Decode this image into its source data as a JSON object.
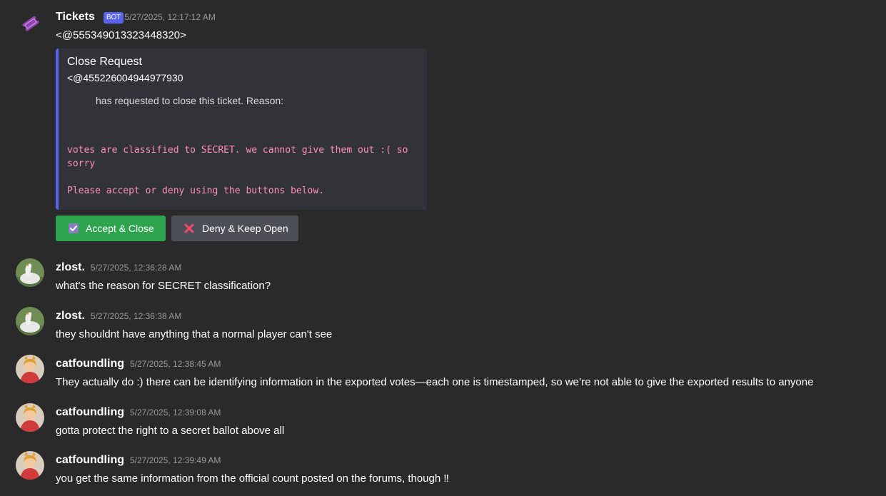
{
  "messages": [
    {
      "username": "Tickets",
      "badge": "BOT",
      "timestamp": "5/27/2025, 12:17:12 AM",
      "content": "<@555349013323448320>",
      "embed": {
        "title": "Close Request",
        "mention": "<@455226004944977930",
        "description": "has requested to close this ticket. Reason:",
        "code_lines": [
          "votes are classified to SECRET. we cannot give them out :( so",
          "sorry",
          "",
          "Please accept or deny using the buttons below."
        ],
        "accent_color": "#5865f2"
      },
      "buttons": {
        "accept_label": "Accept & Close",
        "deny_label": "Deny & Keep Open"
      }
    },
    {
      "username": "zlost.",
      "timestamp": "5/27/2025, 12:36:28 AM",
      "content": "what's the reason for SECRET classification?"
    },
    {
      "username": "zlost.",
      "timestamp": "5/27/2025, 12:36:38 AM",
      "content": "they shouldnt have anything that a normal player can't see"
    },
    {
      "username": "catfoundling",
      "timestamp": "5/27/2025, 12:38:45 AM",
      "content": "They actually do :) there can be identifying information in the exported votes—each one is timestamped, so we’re not able to give the exported results to anyone"
    },
    {
      "username": "catfoundling",
      "timestamp": "5/27/2025, 12:39:08 AM",
      "content": "gotta protect the right to a secret ballot above all"
    },
    {
      "username": "catfoundling",
      "timestamp": "5/27/2025, 12:39:49 AM",
      "content": "you get the same information from the official count posted on the forums, though ‼"
    }
  ],
  "icons": {
    "bot_avatar": "ticket-icon",
    "user_avatar_zlost": "goose-avatar",
    "user_avatar_catfoundling": "cat-avatar",
    "accept_icon": "checkbox-check-icon",
    "deny_icon": "cross-icon"
  },
  "colors": {
    "background": "#2a2a2a",
    "embed_background": "#323339",
    "embed_accent": "#5865f2",
    "accept_button": "#2fa44f",
    "deny_button": "#4c4f58",
    "code_text": "#ff8fb9",
    "timestamp": "#9a9a9a",
    "bot_badge": "#5865f2"
  }
}
